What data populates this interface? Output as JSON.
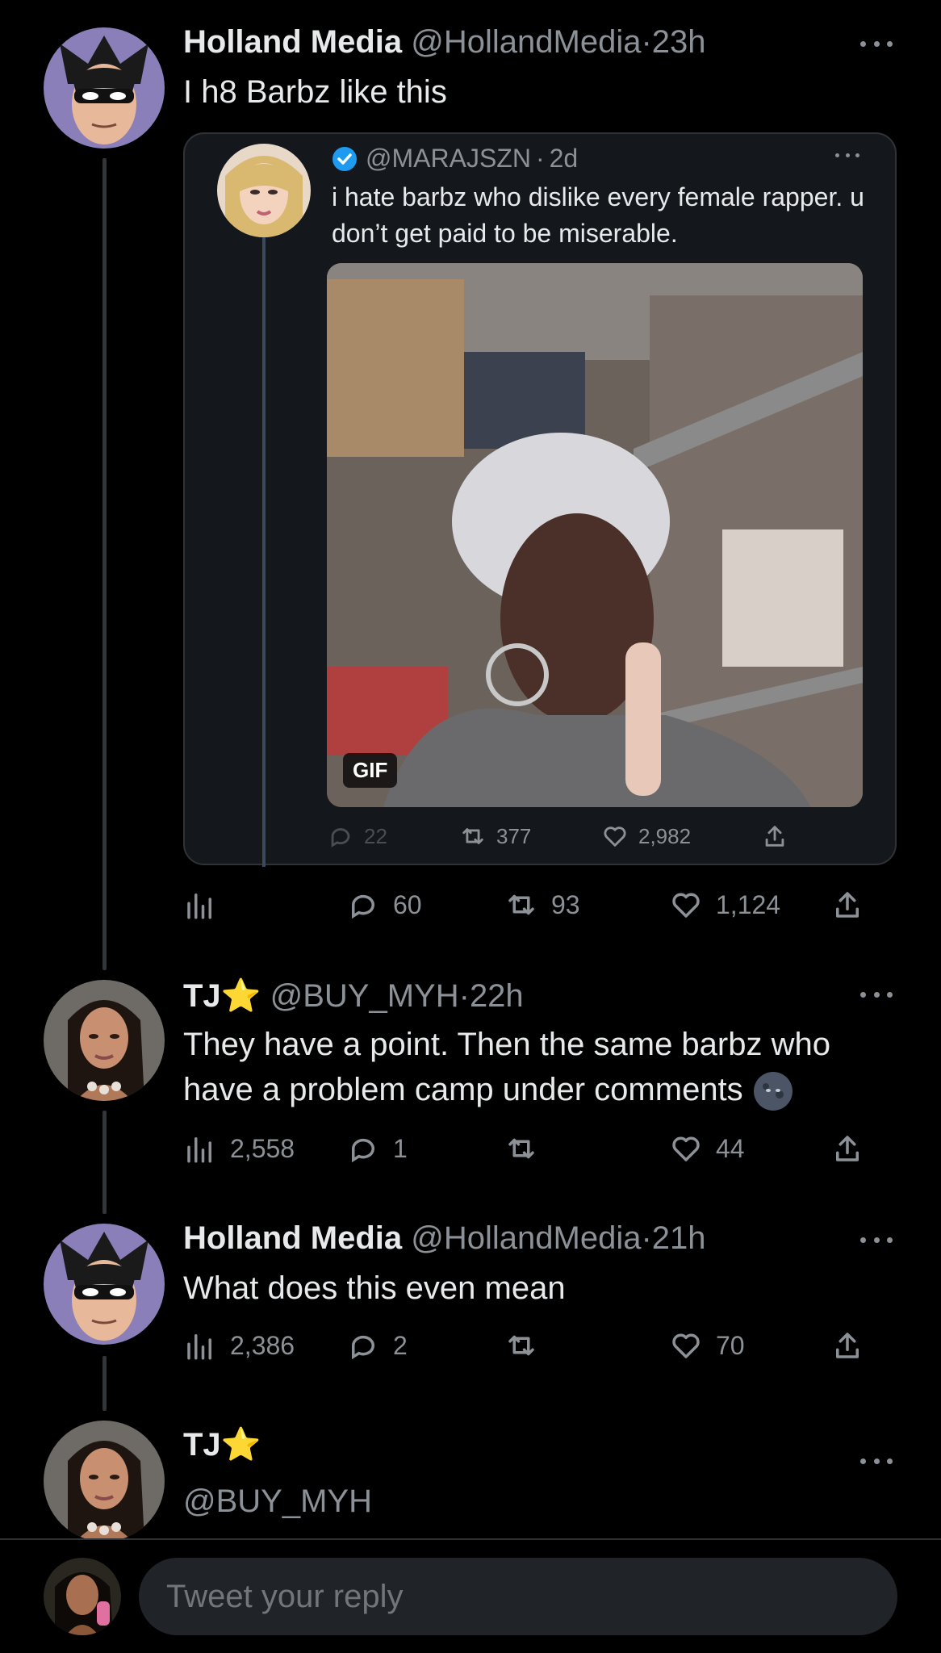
{
  "tweets": [
    {
      "name": "Holland Media",
      "handle": "@HollandMedia",
      "dot": "·",
      "time": "23h",
      "text": "I h8 Barbz like this",
      "quote": {
        "handle": "@MARAJSZN",
        "dot": "·",
        "time": "2d",
        "text": "i hate barbz who dislike every female rapper. u don’t get paid to be miserable.",
        "gif_label": "GIF",
        "replies": "22",
        "retweets": "377",
        "likes": "2,982"
      },
      "replies": "60",
      "retweets": "93",
      "likes": "1,124"
    },
    {
      "name": "TJ",
      "star": "⭐",
      "handle": "@BUY_MYH",
      "dot": "·",
      "time": "22h",
      "text_line1": "They have a point. Then the same barbz who",
      "text_line2": "have a problem camp under comments",
      "views": "2,558",
      "replies": "1",
      "likes": "44"
    },
    {
      "name": "Holland Media",
      "handle": "@HollandMedia",
      "dot": "·",
      "time": "21h",
      "text": "What does this even mean",
      "views": "2,386",
      "replies": "2",
      "likes": "70"
    },
    {
      "name": "TJ",
      "star": "⭐",
      "handle": "@BUY_MYH"
    }
  ],
  "reply": {
    "placeholder": "Tweet your reply"
  },
  "colors": {
    "background": "#000000",
    "text": "#e7e9ea",
    "secondary": "#8b9196",
    "verified": "#1d9bf0",
    "star": "#ffcc2e"
  }
}
